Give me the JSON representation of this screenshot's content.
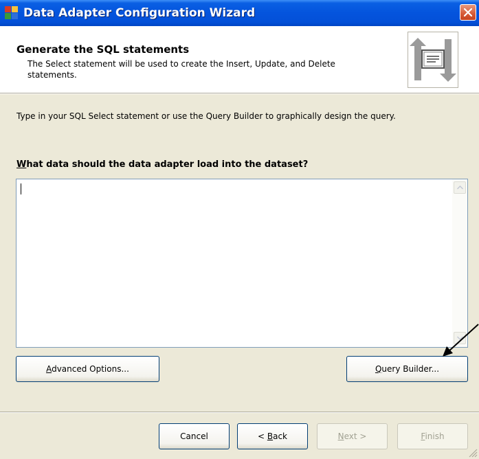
{
  "window": {
    "title": "Data Adapter Configuration Wizard",
    "titlebar_color": "#0454dd",
    "icons": {
      "app": "application-icon",
      "close": "close-icon"
    }
  },
  "header": {
    "title": "Generate the SQL statements",
    "subtitle": "The Select statement will be used to create the Insert, Update, and Delete statements.",
    "graphic": "wizard-sync-icon"
  },
  "body": {
    "instruction": "Type in your SQL Select statement or use the Query Builder to graphically design the query.",
    "question_access_key": "W",
    "question_rest": "hat data should the data adapter load into the dataset?",
    "sql_text": ""
  },
  "buttons": {
    "advanced_key": "A",
    "advanced_rest": "dvanced Options...",
    "query_key": "Q",
    "query_rest": "uery Builder...",
    "cancel": "Cancel",
    "back_prefix": "< ",
    "back_key": "B",
    "back_rest": "ack",
    "next_key": "N",
    "next_rest": "ext >",
    "finish_key": "F",
    "finish_rest": "inish"
  },
  "state": {
    "next_enabled": false,
    "finish_enabled": false
  }
}
